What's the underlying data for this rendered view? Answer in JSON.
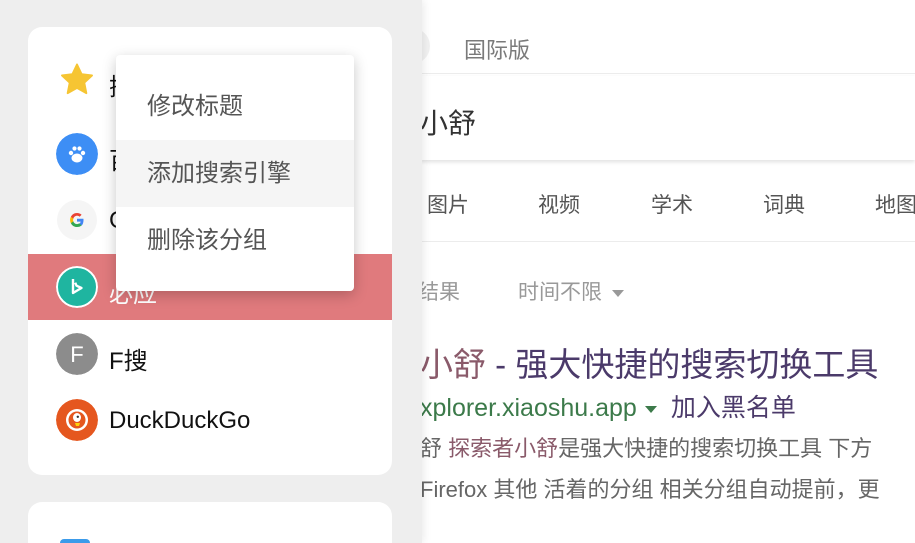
{
  "page": {
    "intl_label": "国际版",
    "query": "小舒",
    "tabs": [
      "图片",
      "视频",
      "学术",
      "词典",
      "地图"
    ],
    "filters": {
      "results": "结果",
      "time": "时间不限"
    },
    "result": {
      "title_highlight": "小舒",
      "title_rest": " - 强大快捷的搜索切换工具",
      "url": "xplorer.xiaoshu.app",
      "block_action": "加入黑名单",
      "desc1_lead": "舒 ",
      "desc1_highlight": "探索者小舒",
      "desc1_rest": "是强大快捷的搜索切换工具 下方",
      "desc2": "Firefox 其他 活着的分组 相关分组自动提前，更"
    }
  },
  "sidebar": {
    "engines": [
      {
        "label": "搜",
        "icon": "star-icon",
        "color": "#f6c533"
      },
      {
        "label": "百",
        "icon": "baidu-paw-icon",
        "color": "#3d8ef5"
      },
      {
        "label": "G",
        "icon": "google-icon",
        "color": "#4285f4"
      },
      {
        "label": "必应",
        "icon": "bing-icon",
        "color": "#1fb5a0",
        "active": true
      },
      {
        "label": "F搜",
        "icon": "letter-f-icon",
        "color": "#8c8c8c"
      },
      {
        "label": "DuckDuckGo",
        "icon": "duckduckgo-icon",
        "color": "#e5571f"
      }
    ]
  },
  "context_menu": {
    "items": [
      "修改标题",
      "添加搜索引擎",
      "删除该分组"
    ]
  },
  "colors": {
    "active_row": "#e07a7d",
    "sidebar_bg": "#eeeeee"
  }
}
